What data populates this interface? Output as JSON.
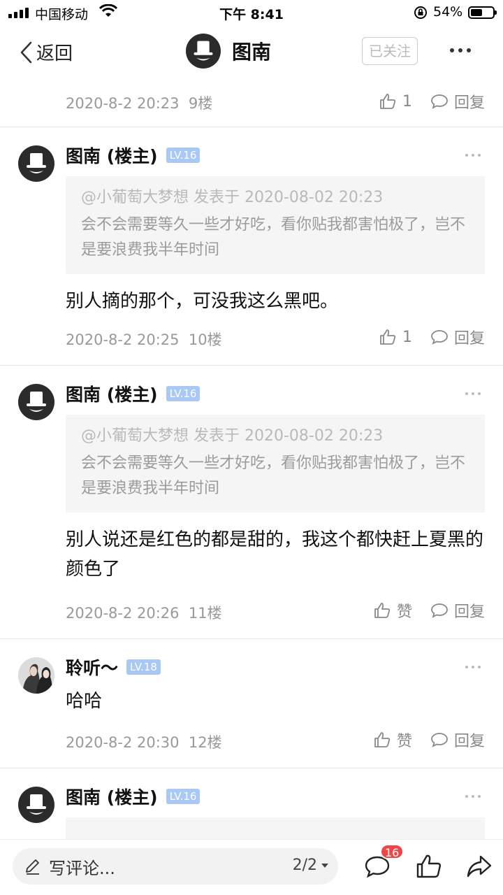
{
  "status_bar": {
    "carrier": "中国移动",
    "time": "下午 8:41",
    "battery_percent": "54%",
    "battery_level": 0.54
  },
  "nav": {
    "back_label": "返回",
    "title": "图南",
    "follow_label": "已关注"
  },
  "posts": [
    {
      "meta": "2020-8-2 20:23",
      "floor": "9楼",
      "like_label": "1",
      "reply_label": "回复"
    },
    {
      "author": "图南 (楼主)",
      "level": "LV.16",
      "quote_head": "@小葡萄大梦想 发表于 2020-08-02 20:23",
      "quote_text": "会不会需要等久一些才好吃，看你贴我都害怕极了，岂不是要浪费我半年时间",
      "content": "别人摘的那个，可没我这么黑吧。",
      "meta": "2020-8-2 20:25",
      "floor": "10楼",
      "like_label": "1",
      "reply_label": "回复"
    },
    {
      "author": "图南 (楼主)",
      "level": "LV.16",
      "quote_head": "@小葡萄大梦想 发表于 2020-08-02 20:23",
      "quote_text": "会不会需要等久一些才好吃，看你贴我都害怕极了，岂不是要浪费我半年时间",
      "content": "别人说还是红色的都是甜的，我这个都快赶上夏黑的颜色了",
      "meta": "2020-8-2 20:26",
      "floor": "11楼",
      "like_label": "赞",
      "reply_label": "回复"
    },
    {
      "author": "聆听～",
      "level": "LV.18",
      "content": "哈哈",
      "meta": "2020-8-2 20:30",
      "floor": "12楼",
      "like_label": "赞",
      "reply_label": "回复"
    },
    {
      "author": "图南 (楼主)",
      "level": "LV.16"
    }
  ],
  "bottom_bar": {
    "placeholder": "写评论...",
    "page": "2/2",
    "comment_count": "16"
  },
  "colors": {
    "level_badge": "#a9c8f5",
    "badge_red": "#f04545",
    "quote_bg": "#f5f5f5"
  }
}
